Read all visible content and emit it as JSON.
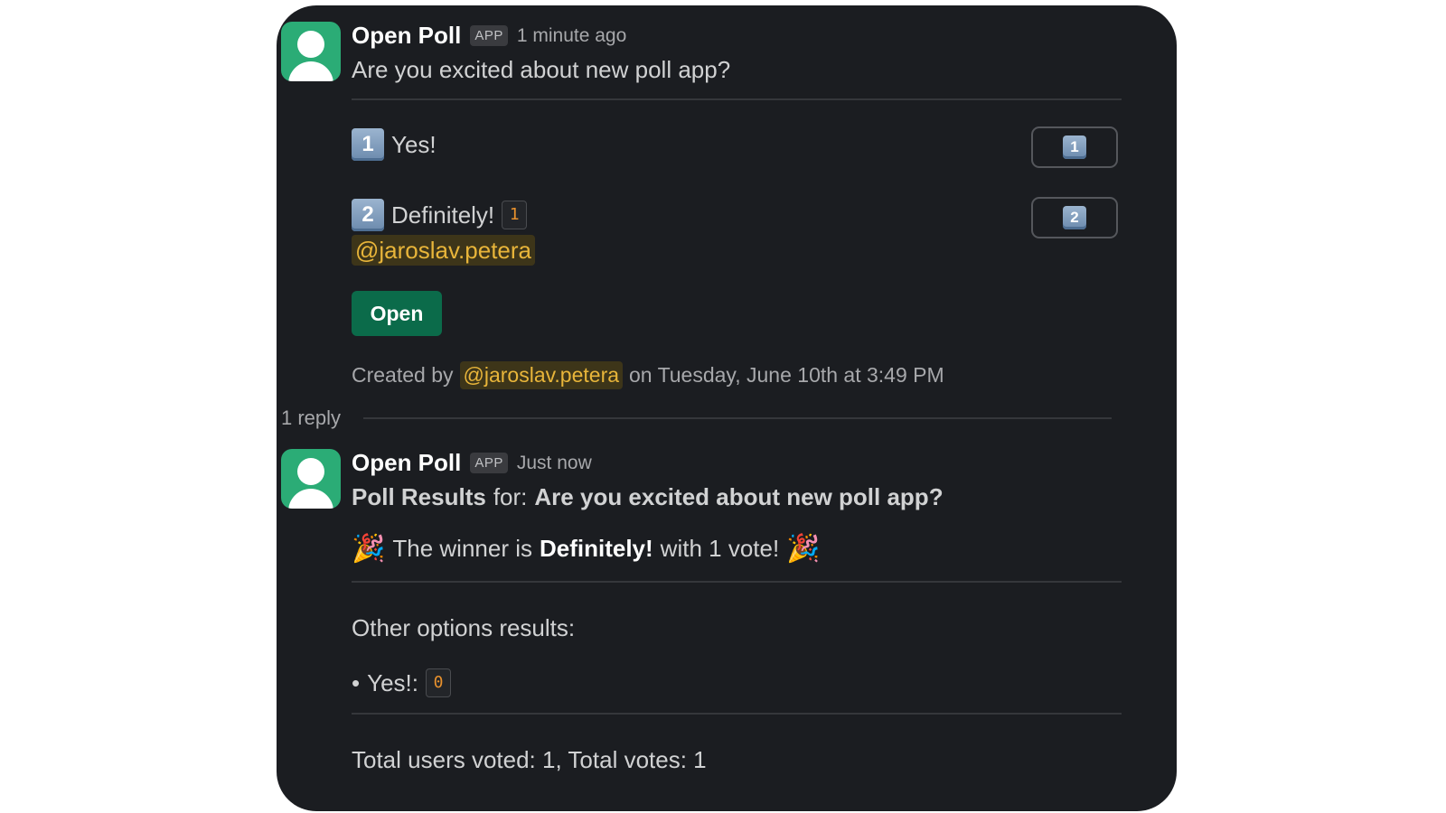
{
  "message1": {
    "author": "Open Poll",
    "badge": "APP",
    "timestamp": "1 minute ago",
    "question": "Are you excited about new poll app?",
    "options": [
      {
        "number": "1",
        "label": "Yes!",
        "count": "",
        "voters": ""
      },
      {
        "number": "2",
        "label": "Definitely!",
        "count": "1",
        "voters": "@jaroslav.petera"
      }
    ],
    "open_button": "Open",
    "created_by_prefix": "Created by",
    "created_by_user": "@jaroslav.petera",
    "created_by_suffix": "on Tuesday, June 10th at 3:49 PM"
  },
  "thread": {
    "replies": "1 reply"
  },
  "message2": {
    "author": "Open Poll",
    "badge": "APP",
    "timestamp": "Just now",
    "results_prefix": "Poll Results",
    "results_for": "for:",
    "results_question": "Are you excited about new poll app?",
    "winner_text_1": "The winner is",
    "winner_option": "Definitely!",
    "winner_text_2": "with 1 vote!",
    "party_icon": "🎉",
    "other_heading": "Other options results:",
    "other_items": [
      {
        "label": "Yes!:",
        "count": "0"
      }
    ],
    "totals": "Total users voted: 1, Total votes: 1"
  },
  "colors": {
    "background": "#1b1d21",
    "accent_green": "#0b6b4a",
    "mention": "#e8b53a",
    "count": "#e8912d"
  }
}
